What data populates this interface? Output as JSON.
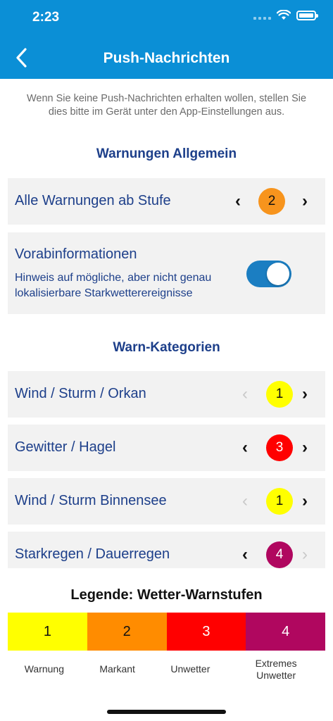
{
  "status_bar": {
    "time": "2:23"
  },
  "nav": {
    "title": "Push-Nachrichten",
    "back_icon": "chevron-left-icon"
  },
  "info_text": "Wenn Sie keine Push-Nachrichten erhalten wollen, stellen Sie dies bitte im Gerät unter den App-Einstellungen aus.",
  "general": {
    "section_title": "Warnungen Allgemein",
    "all_warnings": {
      "label": "Alle Warnungen ab Stufe",
      "level": "2",
      "color": "#f7941d",
      "prev_enabled": true,
      "next_enabled": true
    },
    "pre_info": {
      "label": "Vorabinformationen",
      "description": "Hinweis auf mögliche, aber nicht genau lokalisierbare Starkwetterereignisse",
      "enabled": true
    }
  },
  "categories": {
    "section_title": "Warn-Kategorien",
    "items": [
      {
        "label": "Wind / Sturm / Orkan",
        "level": "1",
        "color": "#ffff00",
        "text_color": "#111111",
        "prev_enabled": false,
        "next_enabled": true
      },
      {
        "label": "Gewitter / Hagel",
        "level": "3",
        "color": "#ff0000",
        "text_color": "#ffffff",
        "prev_enabled": true,
        "next_enabled": true
      },
      {
        "label": "Wind / Sturm Binnensee",
        "level": "1",
        "color": "#ffff00",
        "text_color": "#111111",
        "prev_enabled": false,
        "next_enabled": true
      },
      {
        "label": "Starkregen / Dauerregen",
        "level": "4",
        "color": "#b0075f",
        "text_color": "#ffffff",
        "prev_enabled": true,
        "next_enabled": false
      }
    ]
  },
  "chevrons": {
    "prev": "‹",
    "next": "›"
  },
  "legend": {
    "title": "Legende: Wetter-Warnstufen",
    "levels": [
      {
        "level": "1",
        "label": "Warnung",
        "color": "#ffff00",
        "text_color": "#111111"
      },
      {
        "level": "2",
        "label": "Markant",
        "color": "#ff8c00",
        "text_color": "#111111"
      },
      {
        "level": "3",
        "label": "Unwetter",
        "color": "#ff0000",
        "text_color": "#ffffff"
      },
      {
        "level": "4",
        "label": "Extremes Unwetter",
        "color": "#b0075f",
        "text_color": "#ffffff"
      }
    ]
  }
}
